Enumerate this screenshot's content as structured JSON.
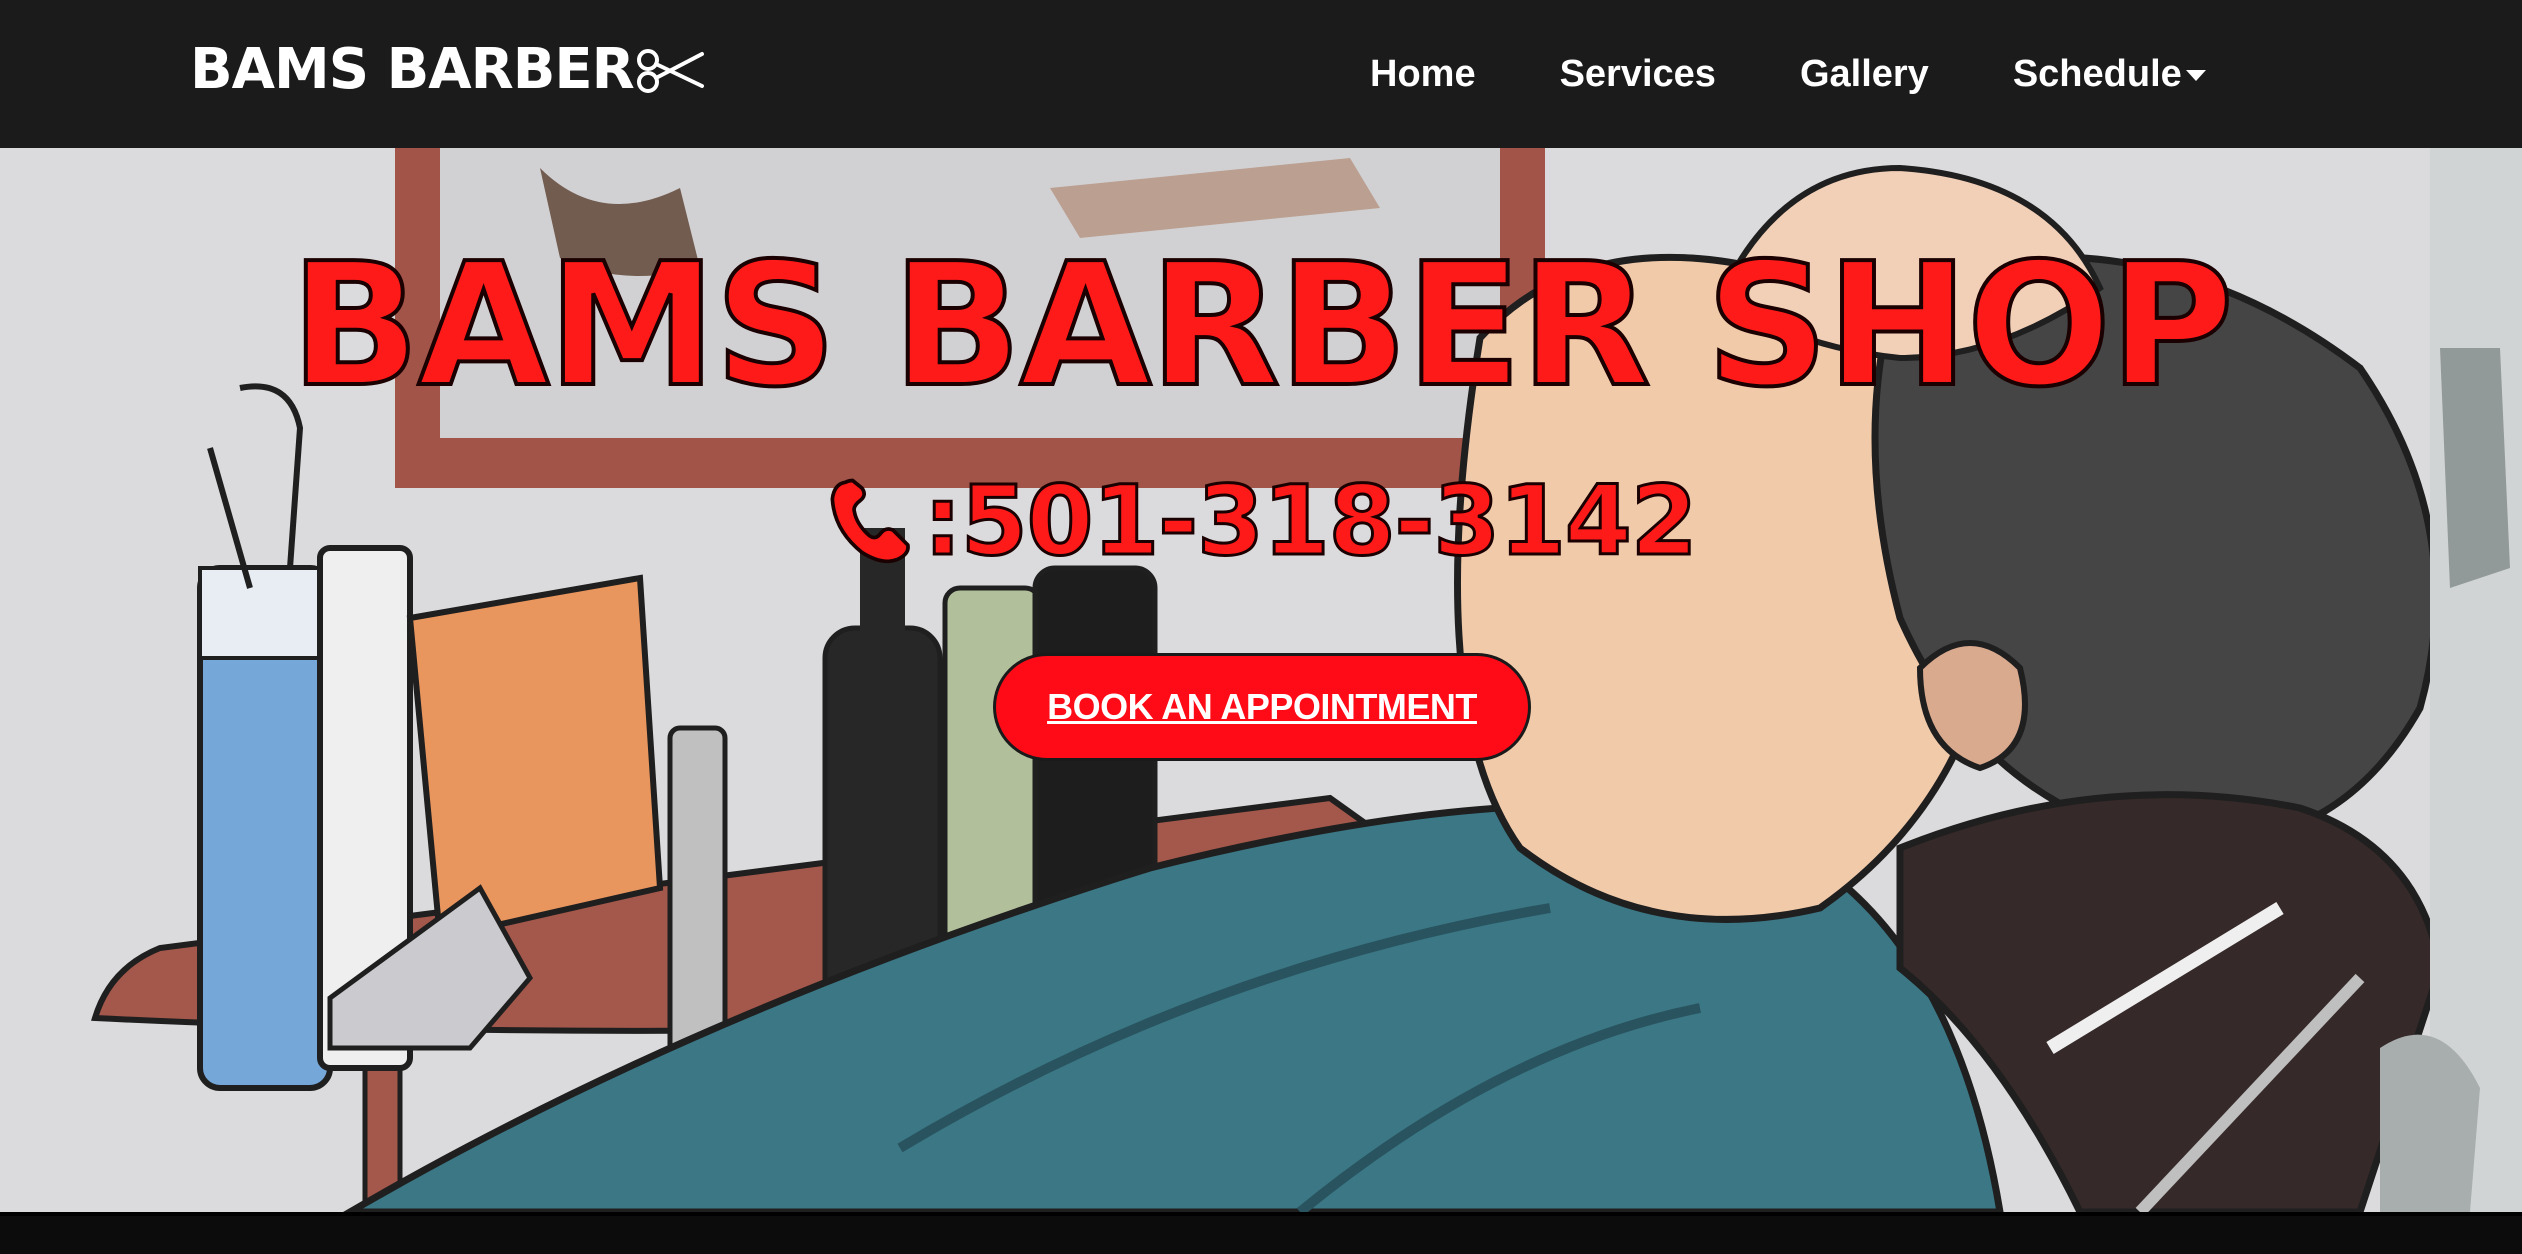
{
  "navbar": {
    "brand": "BAMS BARBER",
    "brand_icon": "scissors-icon",
    "links": [
      {
        "label": "Home"
      },
      {
        "label": "Services"
      },
      {
        "label": "Gallery"
      },
      {
        "label": "Schedule",
        "has_dropdown": true
      }
    ]
  },
  "hero": {
    "title": "BAMS BARBER SHOP",
    "phone_icon": "phone-icon",
    "phone": ":501-318-3142",
    "cta_label": "BOOK AN APPOINTMENT",
    "illustration": "barber-shop-illustration"
  },
  "colors": {
    "navbar_bg": "#1b1b1b",
    "accent_red": "#ff1a1a",
    "cta_bg": "#ff0a17",
    "text_white": "#ffffff"
  }
}
